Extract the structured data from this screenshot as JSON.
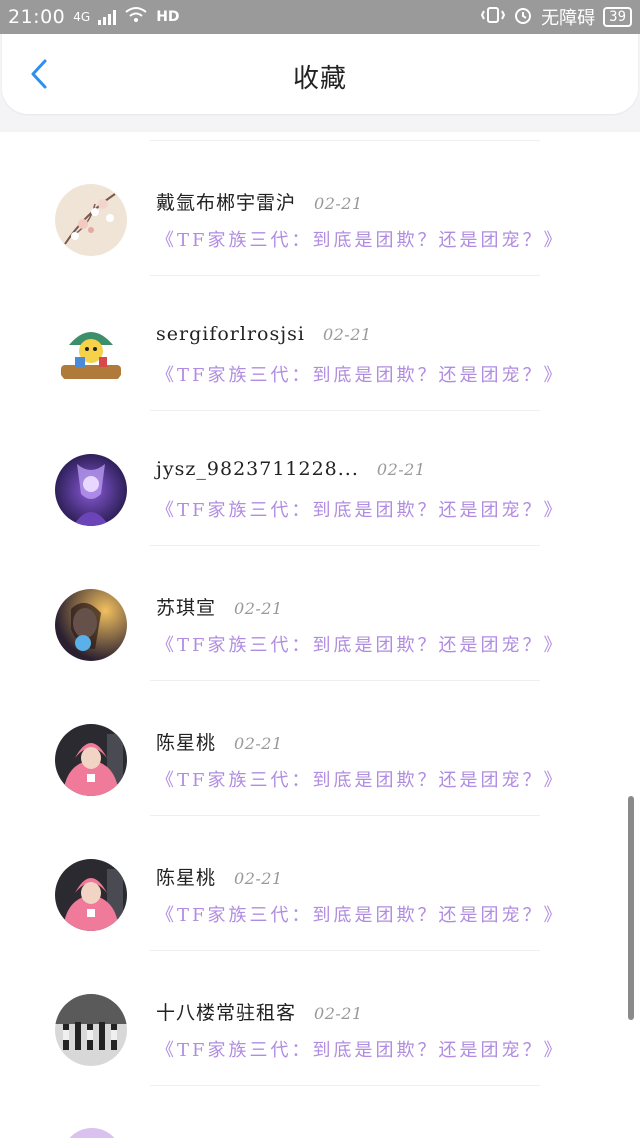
{
  "status_bar": {
    "time": "21:00",
    "network": "4G",
    "hd": "HD",
    "carrier": "无障碍",
    "battery": "39"
  },
  "header": {
    "title": "收藏",
    "back_icon": "chevron-left-icon"
  },
  "items": [
    {
      "name": "戴氩布郴宇雷沪",
      "date": "02-21",
      "quote": "《TF家族三代：到底是团欺？还是团宠？》",
      "avatar": "flowers-painting"
    },
    {
      "name": "sergiforlrosjsi",
      "date": "02-21",
      "quote": "《TF家族三代：到底是团欺？还是团宠？》",
      "avatar": "cartoon-clown"
    },
    {
      "name": "jysz_9823711228...",
      "date": "02-21",
      "quote": "《TF家族三代：到底是团欺？还是团宠？》",
      "avatar": "purple-anime"
    },
    {
      "name": "苏琪宣",
      "date": "02-21",
      "quote": "《TF家族三代：到底是团欺？还是团宠？》",
      "avatar": "girl-portrait"
    },
    {
      "name": "陈星桃",
      "date": "02-21",
      "quote": "《TF家族三代：到底是团欺？还是团宠？》",
      "avatar": "pink-hoodie"
    },
    {
      "name": "陈星桃",
      "date": "02-21",
      "quote": "《TF家族三代：到底是团欺？还是团宠？》",
      "avatar": "pink-hoodie"
    },
    {
      "name": "十八楼常驻租客",
      "date": "02-21",
      "quote": "《TF家族三代：到底是团欺？还是团宠？》",
      "avatar": "group-dance"
    }
  ]
}
